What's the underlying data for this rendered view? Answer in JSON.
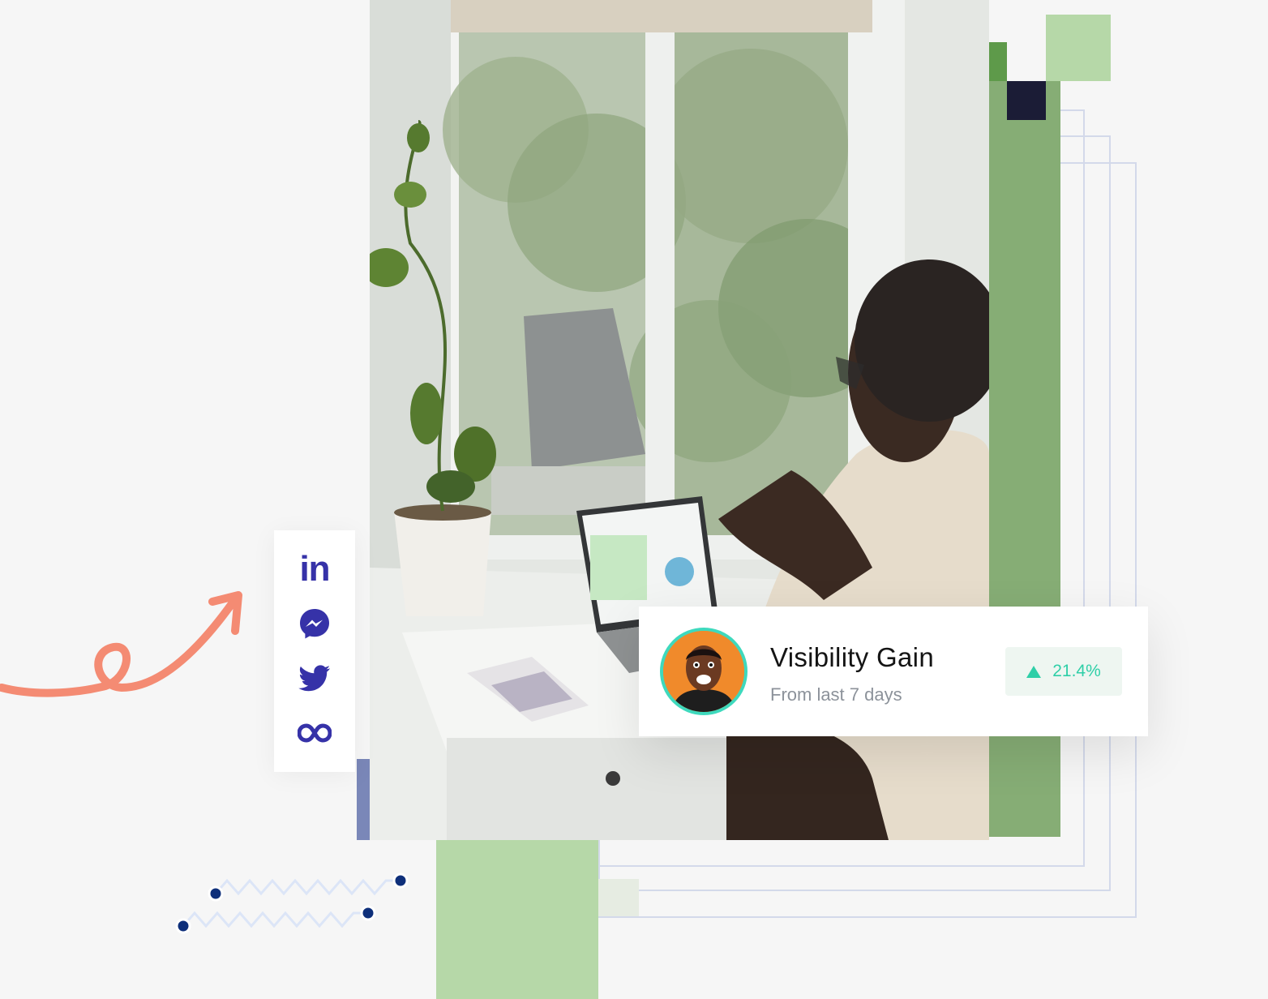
{
  "social": {
    "items": [
      {
        "name": "linkedin",
        "text": "in",
        "icon": "linkedin-icon"
      },
      {
        "name": "messenger",
        "icon": "messenger-icon"
      },
      {
        "name": "twitter",
        "icon": "twitter-icon"
      },
      {
        "name": "meta",
        "icon": "infinity-icon"
      }
    ],
    "icon_color": "#3632a8"
  },
  "stat_card": {
    "title": "Visibility Gain",
    "subtitle": "From last 7 days",
    "change": "21.4%",
    "change_direction": "up",
    "change_color": "#2fcfa8",
    "avatar": "avatar-icon"
  },
  "colors": {
    "green_dark": "#5e9a4a",
    "green_mid": "#86ad75",
    "green_light": "#b6d8a8",
    "navy": "#1b1c36",
    "periwinkle": "#7a87b8",
    "arrow": "#f48b73",
    "dots": "#0e2f7a"
  }
}
